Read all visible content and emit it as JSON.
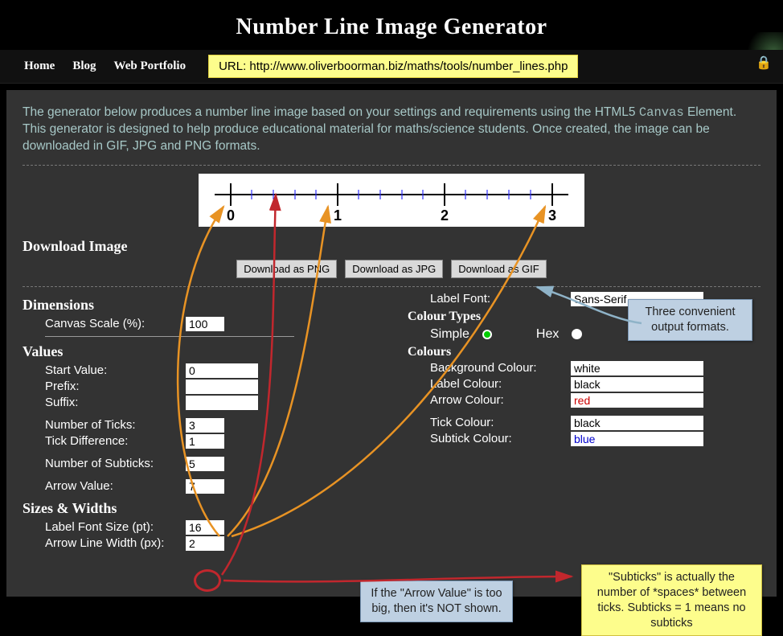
{
  "title": "Number Line Image Generator",
  "nav": {
    "home": "Home",
    "blog": "Blog",
    "portfolio": "Web Portfolio"
  },
  "url_label": "URL: http://www.oliverboorman.biz/maths/tools/number_lines.php",
  "intro_p1": "The generator below produces a number line image based on your settings and requirements using the HTML5",
  "intro_canvas": "Canvas",
  "intro_p2": " Element. This generator is designed to help produce educational material for maths/science students. Once created, the image can be downloaded in GIF, JPG and PNG formats.",
  "numline": {
    "ticks": [
      "0",
      "1",
      "2",
      "3"
    ]
  },
  "sections": {
    "download": "Download Image",
    "dimensions": "Dimensions",
    "values": "Values",
    "sizes": "Sizes & Widths",
    "colourtypes": "Colour Types",
    "colours": "Colours"
  },
  "buttons": {
    "png": "Download as PNG",
    "jpg": "Download as JPG",
    "gif": "Download as GIF"
  },
  "labels": {
    "canvas_scale": "Canvas Scale (%):",
    "start_value": "Start Value:",
    "prefix": "Prefix:",
    "suffix": "Suffix:",
    "num_ticks": "Number of Ticks:",
    "tick_diff": "Tick Difference:",
    "num_subticks": "Number of Subticks:",
    "arrow_value": "Arrow Value:",
    "label_font_size": "Label Font Size (pt):",
    "arrow_line_width": "Arrow Line Width (px):",
    "label_font": "Label Font:",
    "simple": "Simple",
    "hex": "Hex",
    "bg_colour": "Background Colour:",
    "label_colour": "Label Colour:",
    "arrow_colour": "Arrow Colour:",
    "tick_colour": "Tick Colour:",
    "subtick_colour": "Subtick Colour:"
  },
  "values": {
    "canvas_scale": "100",
    "start_value": "0",
    "prefix": "",
    "suffix": "",
    "num_ticks": "3",
    "tick_diff": "1",
    "num_subticks": "5",
    "arrow_value": "7",
    "label_font_size": "16",
    "arrow_line_width": "2",
    "label_font": "Sans-Serif",
    "bg_colour": "white",
    "label_colour": "black",
    "arrow_colour": "red",
    "tick_colour": "black",
    "subtick_colour": "blue"
  },
  "annotations": {
    "formats": "Three convenient output formats.",
    "arrowval": "If the \"Arrow Value\" is too big, then it's NOT shown.",
    "subticks": "\"Subticks\" is actually the number of *spaces* between ticks. Subticks = 1 means no subticks"
  }
}
